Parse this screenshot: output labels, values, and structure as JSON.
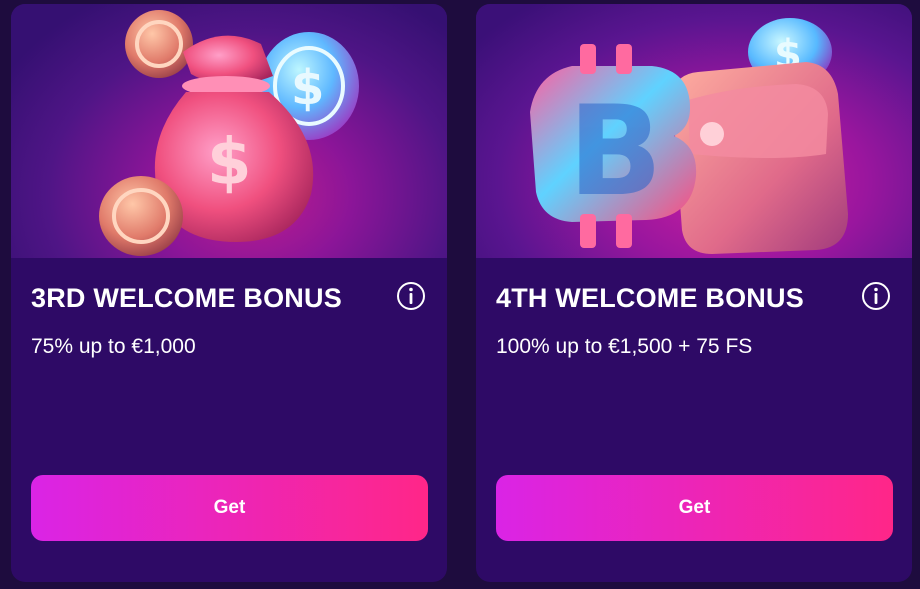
{
  "bonuses": [
    {
      "title": "3RD WELCOME BONUS",
      "description": "75% up to €1,000",
      "button_label": "Get",
      "image_icon": "money-bag-with-coins-icon"
    },
    {
      "title": "4TH WELCOME BONUS",
      "description": "100% up to €1,500 + 75 FS",
      "button_label": "Get",
      "image_icon": "bitcoin-and-wallet-icon"
    }
  ],
  "colors": {
    "page_background": "#1e0c3e",
    "card_background": "#2e0a66",
    "button_gradient_start": "#da24e6",
    "button_gradient_end": "#ff2688",
    "text": "#ffffff"
  }
}
